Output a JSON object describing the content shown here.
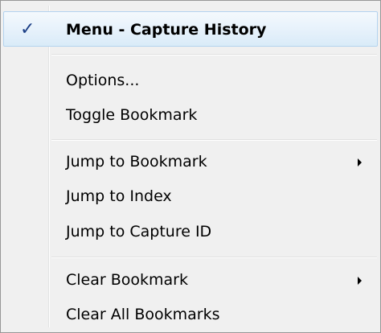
{
  "menu": {
    "checked_item": {
      "label": "Menu - Capture History",
      "check_glyph": "✓"
    },
    "items": [
      {
        "label": "Options..."
      },
      {
        "label": "Toggle Bookmark"
      },
      {
        "label": "Jump to Bookmark",
        "submenu": true
      },
      {
        "label": "Jump to Index"
      },
      {
        "label": "Jump to Capture ID"
      },
      {
        "label": "Clear Bookmark",
        "submenu": true
      },
      {
        "label": "Clear All Bookmarks"
      }
    ],
    "icons": {
      "check": "check-icon",
      "submenu_arrow": "chevron-right-icon"
    },
    "colors": {
      "highlight": "#e6f1fb",
      "highlight_border": "#b3d3ef",
      "check": "#1c3f86",
      "background": "#f0f0f0"
    }
  }
}
